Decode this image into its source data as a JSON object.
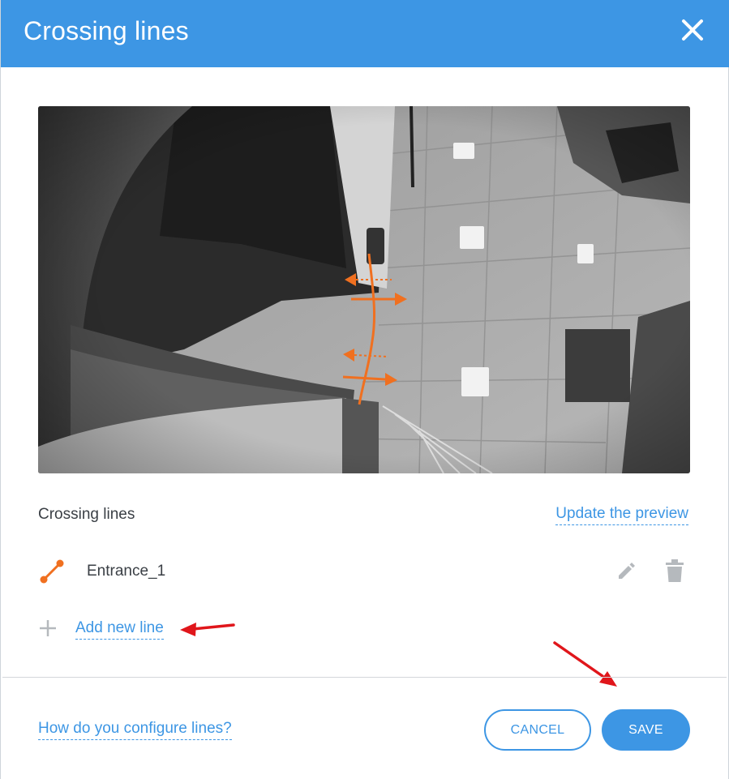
{
  "dialog": {
    "title": "Crossing lines",
    "close_icon": "close-icon"
  },
  "preview": {
    "description_icon": "camera-preview"
  },
  "lines_section": {
    "title": "Crossing lines",
    "update_link": "Update the preview",
    "items": [
      {
        "name": "Entrance_1",
        "icon": "line-segment-icon"
      }
    ],
    "add_label": "Add new line"
  },
  "footer": {
    "help_link": "How do you configure lines?",
    "cancel_label": "CANCEL",
    "save_label": "SAVE"
  },
  "colors": {
    "accent": "#3d96e4",
    "line_orange": "#f07020",
    "annotation_red": "#e0161b"
  }
}
